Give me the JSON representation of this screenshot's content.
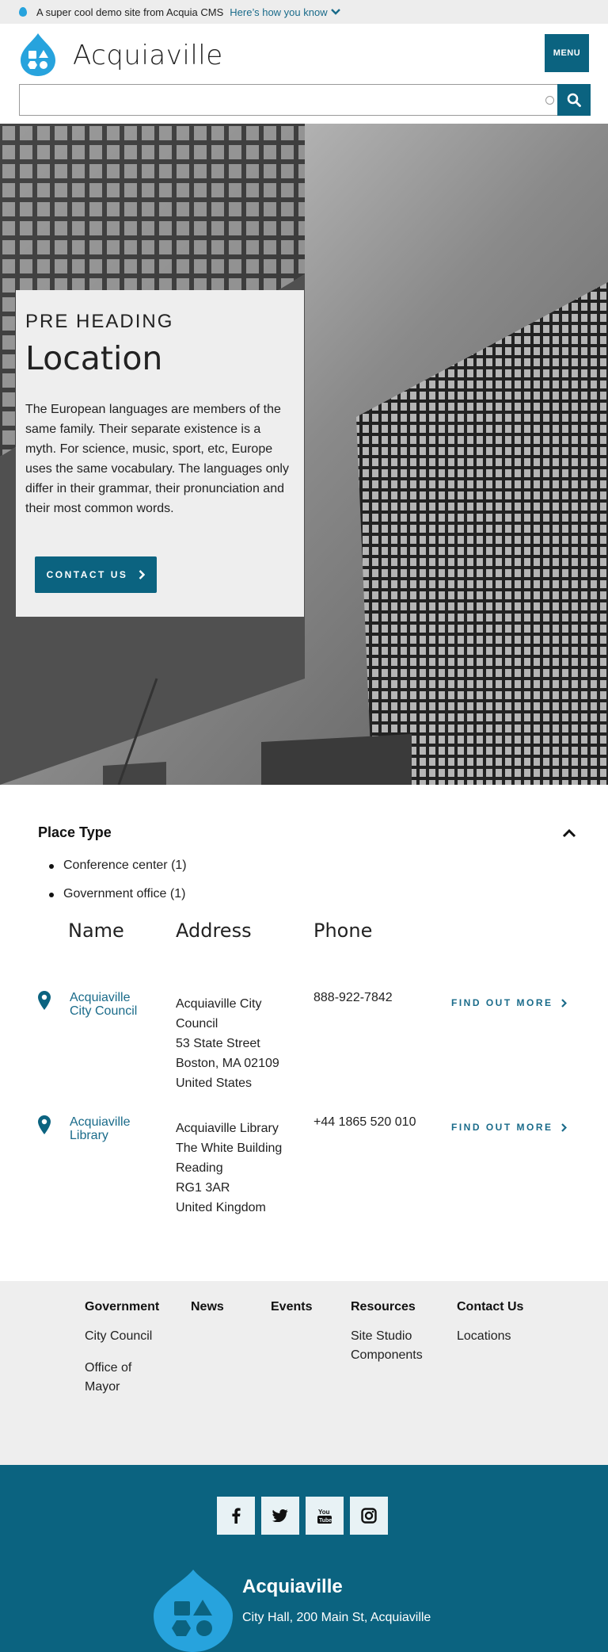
{
  "notice": {
    "text": "A super cool demo site from Acquia CMS",
    "link": "Here’s how you know"
  },
  "header": {
    "site_name": "Acquiaville",
    "menu_label": "MENU",
    "search_placeholder": ""
  },
  "hero": {
    "pre_heading": "PRE HEADING",
    "title": "Location",
    "text": "The European languages are members of the same family. Their separate existence is a myth. For science, music, sport, etc, Europe uses the same vocabulary. The languages only differ in their grammar, their pronunciation and their most common words.",
    "cta_label": "CONTACT US"
  },
  "filter": {
    "title": "Place Type",
    "options": [
      "Conference center (1)",
      "Government office (1)"
    ]
  },
  "table": {
    "headers": [
      "Name",
      "Address",
      "Phone"
    ],
    "rows": [
      {
        "name_line1": "Acquiaville",
        "name_line2": "City Council",
        "address": [
          "Acquiaville City",
          "Council",
          "53 State Street",
          "Boston, MA 02109",
          "United States"
        ],
        "phone": "888-922-7842",
        "more": "FIND OUT MORE"
      },
      {
        "name_line1": "Acquiaville",
        "name_line2": "Library",
        "address": [
          "Acquiaville Library",
          "The White Building",
          "Reading",
          "RG1 3AR",
          "United Kingdom"
        ],
        "phone": "+44 1865 520 010",
        "more": "FIND OUT MORE"
      }
    ]
  },
  "footer_nav": {
    "columns": [
      {
        "head": "Government",
        "items": [
          "City Council",
          "Office of",
          "Mayor"
        ]
      },
      {
        "head": "News",
        "items": []
      },
      {
        "head": "Events",
        "items": []
      },
      {
        "head": "Resources",
        "items": [
          "Site Studio",
          "Components"
        ]
      },
      {
        "head": "Contact Us",
        "items": [
          "Locations"
        ]
      }
    ]
  },
  "footer": {
    "social_icons": [
      "facebook-icon",
      "twitter-icon",
      "youtube-icon",
      "instagram-icon"
    ],
    "name": "Acquiaville",
    "address": "City Hall, 200 Main St, Acquiaville"
  },
  "colors": {
    "primary": "#0b6380",
    "link": "#1a6b8a",
    "logo_blue": "#27a3dd",
    "light_bg": "#eeeeee"
  }
}
